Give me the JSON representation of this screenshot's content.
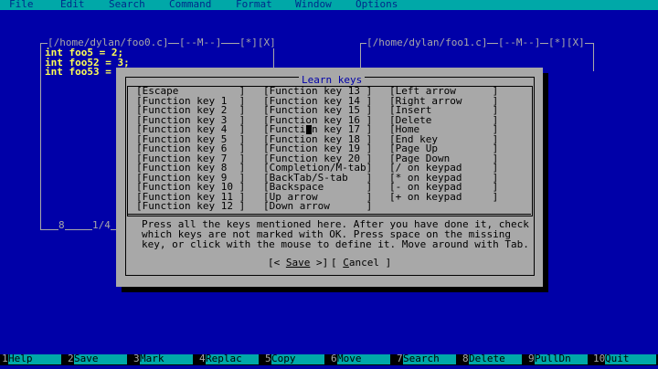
{
  "menubar": {
    "items": [
      "File",
      "Edit",
      "Search",
      "Command",
      "Format",
      "Window",
      "Options"
    ]
  },
  "pane_left": {
    "path": "[/home/dylan/foo0.c]",
    "mode": "[--M--]",
    "buttons": "[*][X]",
    "lines": [
      "int foo5 = 2;",
      "int foo52 = 3;",
      "int foo53 = 4"
    ],
    "status_line": "8",
    "status_pos": "1/4"
  },
  "pane_right": {
    "path": "[/home/dylan/foo1.c]",
    "mode": "[--M--]",
    "buttons": "[*][X]"
  },
  "dialog": {
    "title": "Learn keys",
    "col1": [
      "[Escape          ]",
      "[Function key 1  ]",
      "[Function key 2  ]",
      "[Function key 3  ]",
      "[Function key 4  ]",
      "[Function key 5  ]",
      "[Function key 6  ]",
      "[Function key 7  ]",
      "[Function key 8  ]",
      "[Function key 9  ]",
      "[Function key 10 ]",
      "[Function key 11 ]",
      "[Function key 12 ]"
    ],
    "col2": [
      "[Function key 13 ]",
      "[Function key 14 ]",
      "[Function key 15 ]",
      "[Function key 16 ]",
      "[Function key 17 ]",
      "[Function key 18 ]",
      "[Function key 19 ]",
      "[Function key 20 ]",
      "[Completion/M-tab]",
      "[BackTab/S-tab   ]",
      "[Backspace       ]",
      "[Up arrow        ]",
      "[Down arrow      ]"
    ],
    "col3": [
      "[Left arrow      ]",
      "[Right arrow     ]",
      "[Insert          ]",
      "[Delete          ]",
      "[Home            ]",
      "[End key         ]",
      "[Page Up         ]",
      "[Page Down       ]",
      "[/ on keypad     ]",
      "[* on keypad     ]",
      "[- on keypad     ]",
      "[+ on keypad     ]"
    ],
    "help": [
      "Press all the keys mentioned here. After you have done it, check",
      "which keys are not marked with OK. Press space on the missing",
      "key, or click with the mouse to define it. Move around with Tab."
    ],
    "save_prefix": "[< ",
    "save_label": "Save",
    "save_suffix": " >]",
    "cancel_prefix": "[ ",
    "cancel_hot": "C",
    "cancel_rest": "ancel",
    "cancel_suffix": " ]"
  },
  "fkbar": [
    {
      "num": "1",
      "label": "Help"
    },
    {
      "num": "2",
      "label": "Save"
    },
    {
      "num": "3",
      "label": "Mark"
    },
    {
      "num": "4",
      "label": "Replac"
    },
    {
      "num": "5",
      "label": "Copy"
    },
    {
      "num": "6",
      "label": "Move"
    },
    {
      "num": "7",
      "label": "Search"
    },
    {
      "num": "8",
      "label": "Delete"
    },
    {
      "num": "9",
      "label": "PullDn"
    },
    {
      "num": "10",
      "label": "Quit"
    }
  ],
  "colors": {
    "background": "#0000a8",
    "menubar": "#00a8a8",
    "dialog": "#a8a8a8",
    "code": "#ffff55"
  }
}
